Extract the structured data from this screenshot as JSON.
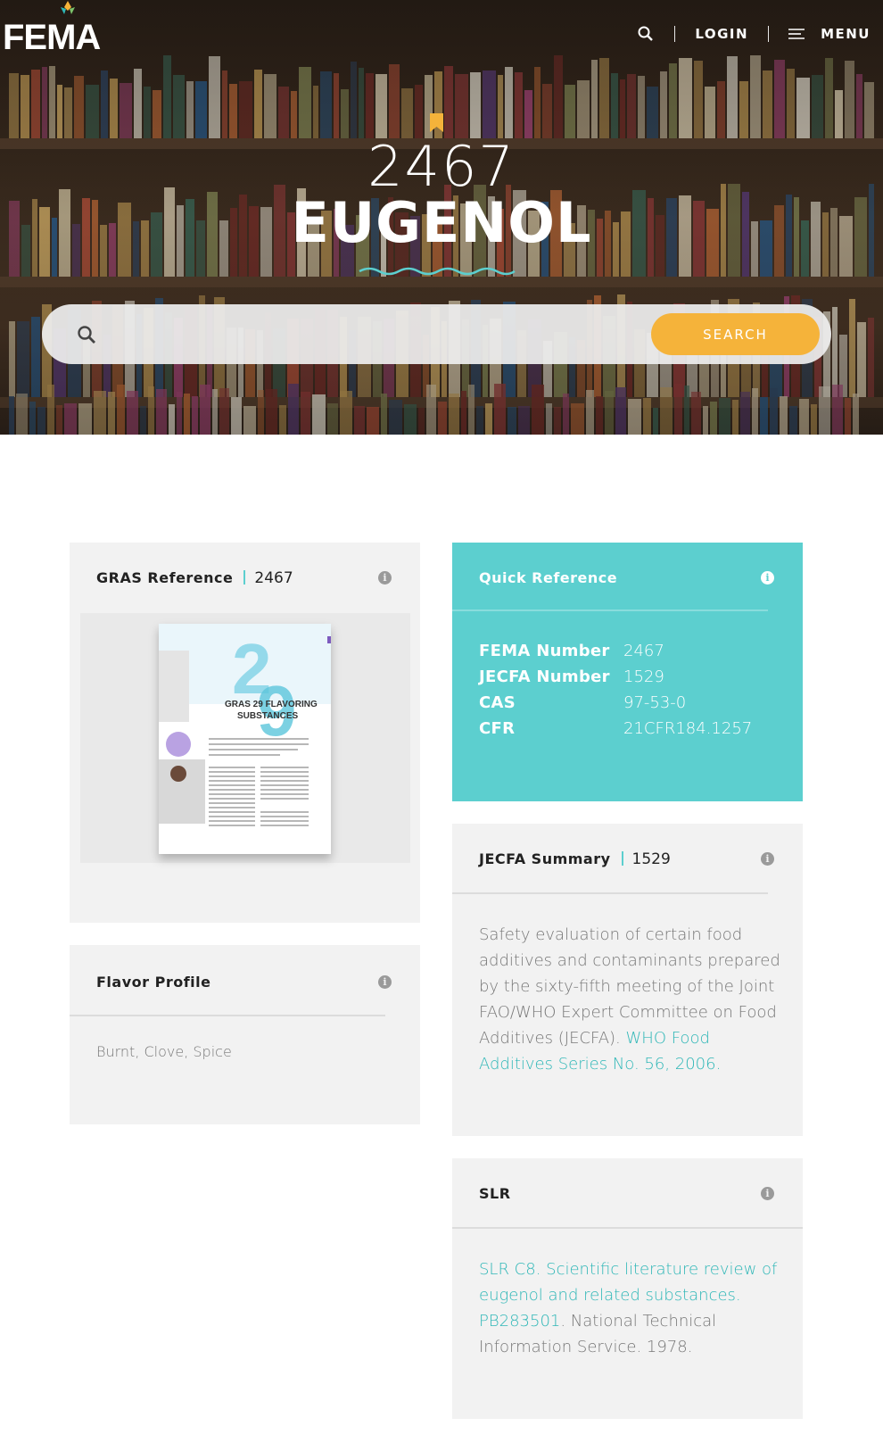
{
  "nav": {
    "logo_text": "FEMA",
    "login_label": "LOGIN",
    "menu_label": "MENU"
  },
  "hero": {
    "fema_number": "2467",
    "substance_name": "EUGENOL"
  },
  "search": {
    "placeholder": "",
    "button_label": "SEARCH"
  },
  "gras": {
    "title": "GRAS Reference",
    "value": "2467",
    "cover_title": "GRAS 29 FLAVORING SUBSTANCES"
  },
  "quick_reference": {
    "title": "Quick Reference",
    "rows": [
      {
        "key": "FEMA Number",
        "value": "2467"
      },
      {
        "key": "JECFA Number",
        "value": "1529"
      },
      {
        "key": "CAS",
        "value": "97-53-0"
      },
      {
        "key": "CFR",
        "value": "21CFR184.1257"
      }
    ]
  },
  "flavor_profile": {
    "title": "Flavor Profile",
    "text": "Burnt, Clove, Spice"
  },
  "jecfa": {
    "title": "JECFA Summary",
    "value": "1529",
    "text": "Safety evaluation of certain food additives and contaminants prepared by the sixty-fifth meeting of the Joint FAO/WHO Expert Committee on Food Additives (JECFA).",
    "link": "WHO Food Additives Series No. 56, 2006."
  },
  "slr": {
    "title": "SLR",
    "link1": "SLR C8. Scientific literature review of eugenol and related substances.",
    "link2": "PB283501",
    "text": ". National Technical Information Service. 1978."
  },
  "colors": {
    "accent_teal": "#5ccfcf",
    "search_button": "#f5b33a",
    "card_bg": "#f2f2f2"
  }
}
